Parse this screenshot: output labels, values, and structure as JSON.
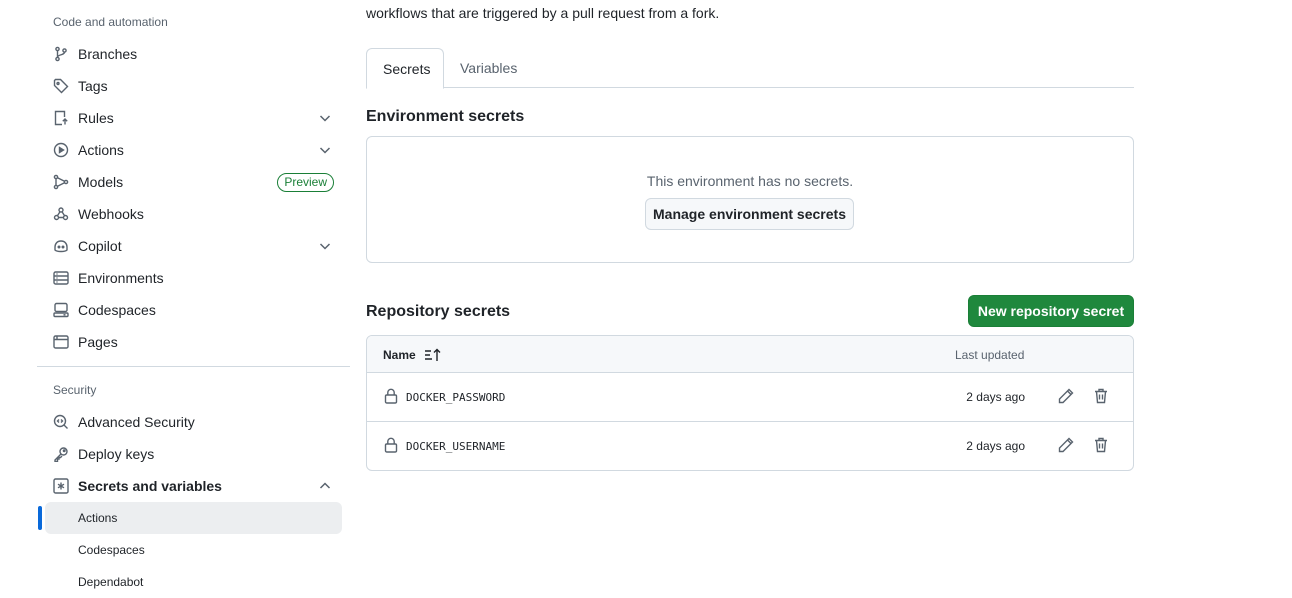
{
  "sidebar": {
    "code_section_heading": "Code and automation",
    "code_items": [
      {
        "label": "Branches",
        "icon": "git-branch-icon"
      },
      {
        "label": "Tags",
        "icon": "tag-icon"
      },
      {
        "label": "Rules",
        "icon": "rules-icon",
        "expandable": true
      },
      {
        "label": "Actions",
        "icon": "play-icon",
        "expandable": true
      },
      {
        "label": "Models",
        "icon": "models-icon",
        "badge": "Preview"
      },
      {
        "label": "Webhooks",
        "icon": "webhook-icon"
      },
      {
        "label": "Copilot",
        "icon": "copilot-icon",
        "expandable": true
      },
      {
        "label": "Environments",
        "icon": "server-icon"
      },
      {
        "label": "Codespaces",
        "icon": "codespaces-icon"
      },
      {
        "label": "Pages",
        "icon": "browser-icon"
      }
    ],
    "security_section_heading": "Security",
    "security_items": [
      {
        "label": "Advanced Security",
        "icon": "codescan-icon"
      },
      {
        "label": "Deploy keys",
        "icon": "key-icon"
      },
      {
        "label": "Secrets and variables",
        "icon": "asterisk-icon",
        "expanded": true
      }
    ],
    "sub_items": [
      {
        "label": "Actions",
        "active": true
      },
      {
        "label": "Codespaces"
      },
      {
        "label": "Dependabot"
      }
    ]
  },
  "main": {
    "intro_text": "workflows that are triggered by a pull request from a fork.",
    "tabs": [
      {
        "label": "Secrets",
        "selected": true
      },
      {
        "label": "Variables"
      }
    ],
    "environment_secrets": {
      "heading": "Environment secrets",
      "empty_text": "This environment has no secrets.",
      "manage_button": "Manage environment secrets"
    },
    "repository_secrets": {
      "heading": "Repository secrets",
      "new_button": "New repository secret",
      "columns": {
        "name": "Name",
        "last_updated": "Last updated"
      },
      "rows": [
        {
          "name": "DOCKER_PASSWORD",
          "updated": "2 days ago"
        },
        {
          "name": "DOCKER_USERNAME",
          "updated": "2 days ago"
        }
      ]
    }
  },
  "colors": {
    "accent_blue": "#0969da",
    "primary_green": "#1f883d",
    "muted_text": "#59636e",
    "border": "#d1d9e0"
  }
}
